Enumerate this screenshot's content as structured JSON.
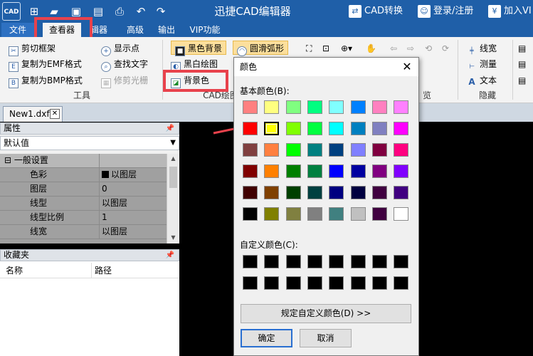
{
  "app": {
    "logo_text": "CAD",
    "title": "迅捷CAD编辑器",
    "cad_convert": "CAD转换",
    "login": "登录/注册",
    "join_vip": "加入VI"
  },
  "menu": {
    "file": "文件",
    "viewer": "查看器",
    "editor": "辑器",
    "advanced": "高级",
    "output": "输出",
    "vip": "VIP功能"
  },
  "ribbon": {
    "tools": {
      "clip_frame": "剪切框架",
      "copy_emf": "复制为EMF格式",
      "copy_bmp": "复制为BMP格式",
      "show_points": "显示点",
      "find_text": "查找文字",
      "trim_raster": "修剪光栅",
      "group_label": "工具"
    },
    "cad_draw": {
      "black_bg": "黑色背景",
      "bw_drawing": "黑白绘图",
      "bg_color": "背景色",
      "smooth_arc": "圆滑弧形",
      "group_label": "CAD绘图"
    },
    "view": {
      "group_label": "览"
    },
    "hide": {
      "line_width": "线宽",
      "measure": "测量",
      "text": "文本",
      "group_label": "隐藏"
    }
  },
  "doc_tab": {
    "label": "New1.dxf"
  },
  "properties": {
    "header": "属性",
    "default_value": "默认值",
    "category": "一般设置",
    "rows": [
      {
        "key": "色彩",
        "value": "以图层"
      },
      {
        "key": "图层",
        "value": "0"
      },
      {
        "key": "线型",
        "value": "以图层"
      },
      {
        "key": "线型比例",
        "value": "1"
      },
      {
        "key": "线宽",
        "value": "以图层"
      }
    ]
  },
  "favorites": {
    "header": "收藏夹",
    "col_name": "名称",
    "col_path": "路径"
  },
  "color_dialog": {
    "title": "颜色",
    "basic_colors_label": "基本颜色(B):",
    "custom_colors_label": "自定义颜色(C):",
    "define_custom_button": "规定自定义颜色(D) >>",
    "ok": "确定",
    "cancel": "取消",
    "selected_color": "#FFFF00",
    "basic_colors": [
      [
        "#FF8080",
        "#FFFF80",
        "#80FF80",
        "#00FF80",
        "#80FFFF",
        "#0080FF",
        "#FF80C0",
        "#FF80FF"
      ],
      [
        "#FF0000",
        "#FFFF00",
        "#80FF00",
        "#00FF40",
        "#00FFFF",
        "#0080C0",
        "#8080C0",
        "#FF00FF"
      ],
      [
        "#804040",
        "#FF8040",
        "#00FF00",
        "#008080",
        "#004080",
        "#8080FF",
        "#800040",
        "#FF0080"
      ],
      [
        "#800000",
        "#FF8000",
        "#008000",
        "#008040",
        "#0000FF",
        "#0000A0",
        "#800080",
        "#8000FF"
      ],
      [
        "#400000",
        "#804000",
        "#004000",
        "#004040",
        "#000080",
        "#000040",
        "#400040",
        "#400080"
      ],
      [
        "#000000",
        "#808000",
        "#808040",
        "#808080",
        "#408080",
        "#C0C0C0",
        "#400040",
        "#FFFFFF"
      ]
    ],
    "custom_colors": [
      [
        "#000000",
        "#000000",
        "#000000",
        "#000000",
        "#000000",
        "#000000",
        "#000000",
        "#000000"
      ],
      [
        "#000000",
        "#000000",
        "#000000",
        "#000000",
        "#000000",
        "#000000",
        "#000000",
        "#000000"
      ]
    ]
  },
  "colors": {
    "titlebar": "#1f5fa8",
    "highlight_box": "#e8424c",
    "canvas": "#000000"
  }
}
